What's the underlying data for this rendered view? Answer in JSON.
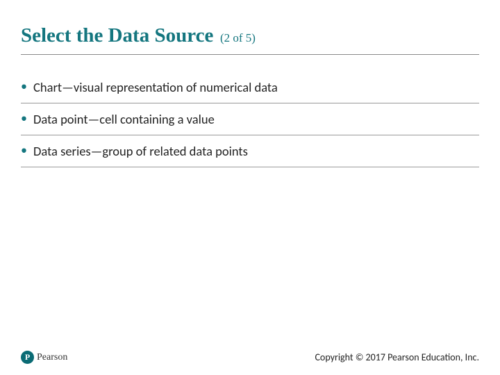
{
  "header": {
    "title": "Select the Data Source",
    "progress": "(2 of 5)"
  },
  "bullets": [
    "Chart—visual representation of numerical data",
    "Data point—cell containing a value",
    "Data series—group of related data points"
  ],
  "footer": {
    "logo_letter": "P",
    "logo_text": "Pearson",
    "copyright": "Copyright © 2017 Pearson Education, Inc."
  }
}
